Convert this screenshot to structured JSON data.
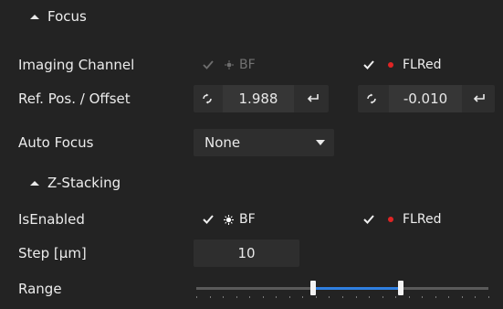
{
  "focus_section": {
    "title": "Focus",
    "caret_icon": "caret-up-icon"
  },
  "imaging_channel": {
    "label": "Imaging Channel",
    "bf": {
      "label": "BF",
      "checked": true,
      "enabled": false,
      "color": "#8a8a8a"
    },
    "flred": {
      "label": "FLRed",
      "checked": true,
      "enabled": true,
      "color": "#e02424"
    }
  },
  "ref_pos": {
    "label": "Ref. Pos. / Offset",
    "ref_value": "1.988",
    "offset_value": "-0.010",
    "sync_icon": "refresh-icon",
    "apply_icon": "return-icon"
  },
  "auto_focus": {
    "label": "Auto Focus",
    "selected": "None"
  },
  "zstack_section": {
    "title": "Z-Stacking",
    "caret_icon": "caret-up-icon"
  },
  "is_enabled": {
    "label": "IsEnabled",
    "bf": {
      "label": "BF",
      "checked": true,
      "color": "#ffffff"
    },
    "flred": {
      "label": "FLRed",
      "checked": true,
      "color": "#e02424"
    }
  },
  "step": {
    "label": "Step [µm]",
    "value": "10"
  },
  "range": {
    "label": "Range",
    "low_fraction": 0.4,
    "high_fraction": 0.7
  },
  "colors": {
    "accent": "#2f7fe0",
    "background": "#232323",
    "field": "#2e2e2e"
  }
}
